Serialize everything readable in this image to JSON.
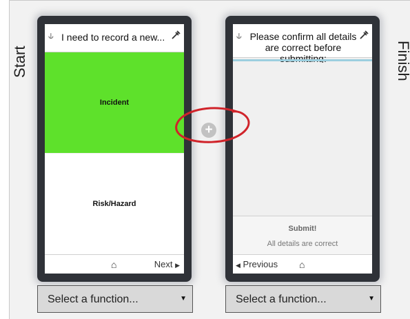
{
  "labels": {
    "start": "Start",
    "finish": "Finish"
  },
  "left_screen": {
    "header": "I need to record a new...",
    "options": [
      "Incident",
      "Risk/Hazard"
    ],
    "footer": {
      "next": "Next"
    }
  },
  "right_screen": {
    "header": "Please confirm all details are correct before submitting:",
    "submit_title": "Submit!",
    "submit_sub": "All details are correct",
    "footer": {
      "previous": "Previous"
    }
  },
  "selects": {
    "left": "Select a function...",
    "right": "Select a function..."
  },
  "icons": {
    "pin": "pin-icon",
    "plug": "plug-icon",
    "home": "home-icon",
    "add": "plus-circle-icon"
  },
  "colors": {
    "selected_option": "#5ee12b",
    "annotation": "#d0232a",
    "phone_frame": "#2f3238",
    "header_bar": "#9ccfdf"
  }
}
